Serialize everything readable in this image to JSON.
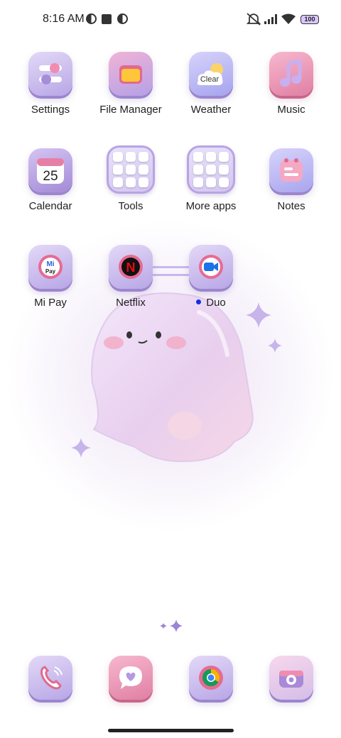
{
  "status_bar": {
    "time": "8:16 AM",
    "battery": "100",
    "icons": [
      "round-notification-icon",
      "square-notification-icon",
      "round-notification-icon",
      "mute-icon",
      "signal-icon",
      "wifi-icon",
      "battery-icon"
    ]
  },
  "apps": [
    {
      "label": "Settings",
      "icon": "settings-icon"
    },
    {
      "label": "File Manager",
      "icon": "folder-icon"
    },
    {
      "label": "Weather",
      "icon": "weather-icon",
      "badge": "Clear"
    },
    {
      "label": "Music",
      "icon": "music-note-icon"
    },
    {
      "label": "Calendar",
      "icon": "calendar-icon",
      "day": "25"
    },
    {
      "label": "Tools",
      "icon": "folder-tools-icon"
    },
    {
      "label": "More apps",
      "icon": "folder-more-apps-icon"
    },
    {
      "label": "Notes",
      "icon": "notes-icon"
    },
    {
      "label": "Mi Pay",
      "icon": "mi-pay-icon",
      "logo_text_top": "Mi",
      "logo_text_bottom": "Pay"
    },
    {
      "label": "Netflix",
      "icon": "netflix-icon",
      "logo_text": "N"
    },
    {
      "label": "Duo",
      "icon": "duo-icon",
      "new_dot": true
    }
  ],
  "dock": [
    {
      "icon": "phone-icon"
    },
    {
      "icon": "messages-icon"
    },
    {
      "icon": "chrome-icon"
    },
    {
      "icon": "camera-icon"
    }
  ],
  "colors": {
    "accent_purple": "#b8a6e6",
    "accent_pink": "#e07fa3",
    "notification_dot": "#1030e0"
  }
}
